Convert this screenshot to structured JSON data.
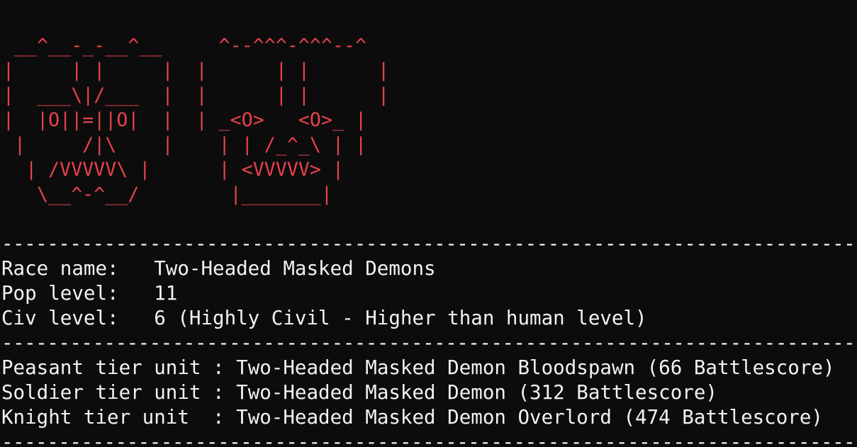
{
  "ascii_art": {
    "lines": [
      " __^__-_-__^__     ^--^^^-^^^--^",
      "|     | |     |  |      | |      |",
      "|  ___\\|/___  |  |      | |      |",
      "|  |O||=||O|  |  | _<O>   <O>_ |",
      " |     /|\\    |    | | /_^_\\ | |",
      "  | /VVVVV\\ |      | <VVVVV> |",
      "   \\__^-^__/        |_______|"
    ]
  },
  "separator": "---------------------------------------------------------------------------------",
  "race_info": {
    "race_name_label": "Race name:   ",
    "race_name_value": "Two-Headed Masked Demons",
    "pop_level_label": "Pop level:   ",
    "pop_level_value": "11",
    "civ_level_label": "Civ level:   ",
    "civ_level_value": "6 (Highly Civil - Higher than human level)"
  },
  "units": {
    "peasant_label": "Peasant tier unit : ",
    "peasant_value": "Two-Headed Masked Demon Bloodspawn (66 Battlescore)",
    "soldier_label": "Soldier tier unit : ",
    "soldier_value": "Two-Headed Masked Demon (312 Battlescore)",
    "knight_label": "Knight tier unit  : ",
    "knight_value": "Two-Headed Masked Demon Overlord (474 Battlescore)"
  },
  "colors": {
    "background": "#0c0c0c",
    "ascii_red": "#e8424d",
    "text_white": "#f2f2f2"
  }
}
